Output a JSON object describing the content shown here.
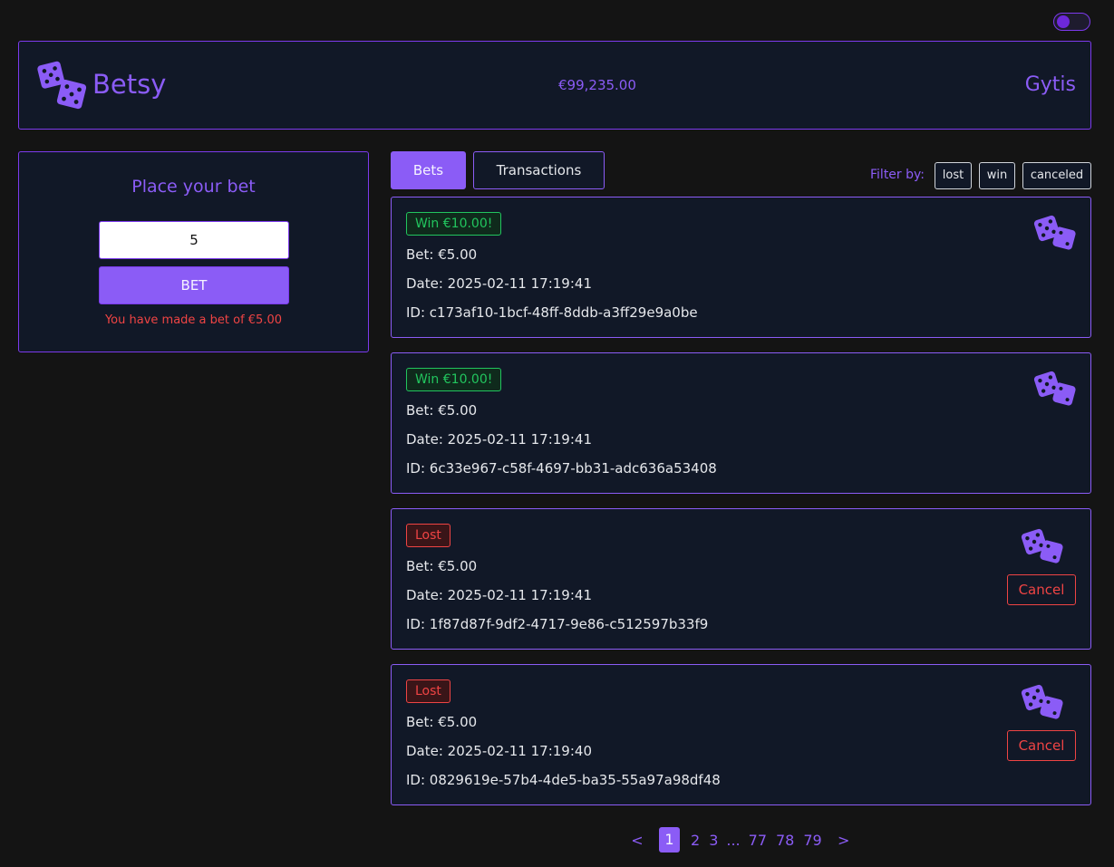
{
  "theme_toggle": {
    "state": "dark"
  },
  "header": {
    "brand": "Betsy",
    "balance": "€99,235.00",
    "user": "Gytis",
    "logo_icon": "dice-icon"
  },
  "bet_panel": {
    "title": "Place your bet",
    "amount_value": "5",
    "button_label": "BET",
    "message": "You have made a bet of €5.00"
  },
  "tabs": [
    {
      "label": "Bets",
      "active": true
    },
    {
      "label": "Transactions",
      "active": false
    }
  ],
  "filter": {
    "label": "Filter by:",
    "options": [
      "lost",
      "win",
      "canceled"
    ]
  },
  "bets": [
    {
      "status": "win",
      "badge": "Win  €10.00!",
      "bet": "Bet: €5.00",
      "date": "Date: 2025-02-11 17:19:41",
      "id": "ID: c173af10-1bcf-48ff-8ddb-a3ff29e9a0be",
      "cancel_label": ""
    },
    {
      "status": "win",
      "badge": "Win  €10.00!",
      "bet": "Bet: €5.00",
      "date": "Date: 2025-02-11 17:19:41",
      "id": "ID: 6c33e967-c58f-4697-bb31-adc636a53408",
      "cancel_label": ""
    },
    {
      "status": "lost",
      "badge": "Lost",
      "bet": "Bet: €5.00",
      "date": "Date: 2025-02-11 17:19:41",
      "id": "ID: 1f87d87f-9df2-4717-9e86-c512597b33f9",
      "cancel_label": "Cancel"
    },
    {
      "status": "lost",
      "badge": "Lost",
      "bet": "Bet: €5.00",
      "date": "Date: 2025-02-11 17:19:40",
      "id": "ID: 0829619e-57b4-4de5-ba35-55a97a98df48",
      "cancel_label": "Cancel"
    }
  ],
  "pagination": {
    "prev": "<",
    "next": ">",
    "current": "1",
    "pages": [
      "2",
      "3"
    ],
    "ellipsis": "...",
    "last_pages": [
      "77",
      "78",
      "79"
    ]
  },
  "colors": {
    "accent": "#8b5cf6",
    "win": "#22c55e",
    "lost": "#ef4444",
    "background": "#141414",
    "panel": "#111827"
  }
}
